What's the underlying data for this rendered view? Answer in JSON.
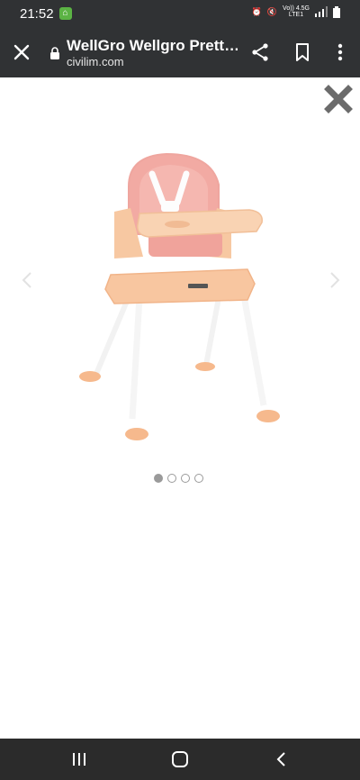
{
  "status_bar": {
    "time": "21:52",
    "net_line1": "Vo)) 4.5G",
    "net_line2": "LTE1"
  },
  "toolbar": {
    "title": "WellGro Wellgro Prett…",
    "url": "civilim.com"
  },
  "carousel": {
    "slide_count": 4,
    "active_index": 0
  },
  "icons": {
    "close": "close-icon",
    "lock": "lock-icon",
    "share": "share-icon",
    "bookmark": "bookmark-icon",
    "more": "more-vert-icon",
    "overlay_close": "close-icon",
    "prev": "chevron-left-icon",
    "next": "chevron-right-icon",
    "recents": "recents-icon",
    "home": "home-icon",
    "back": "back-icon"
  },
  "colors": {
    "bar_bg": "#303234",
    "chair": "#f6c9a6",
    "seat": "#f0a8a2"
  }
}
